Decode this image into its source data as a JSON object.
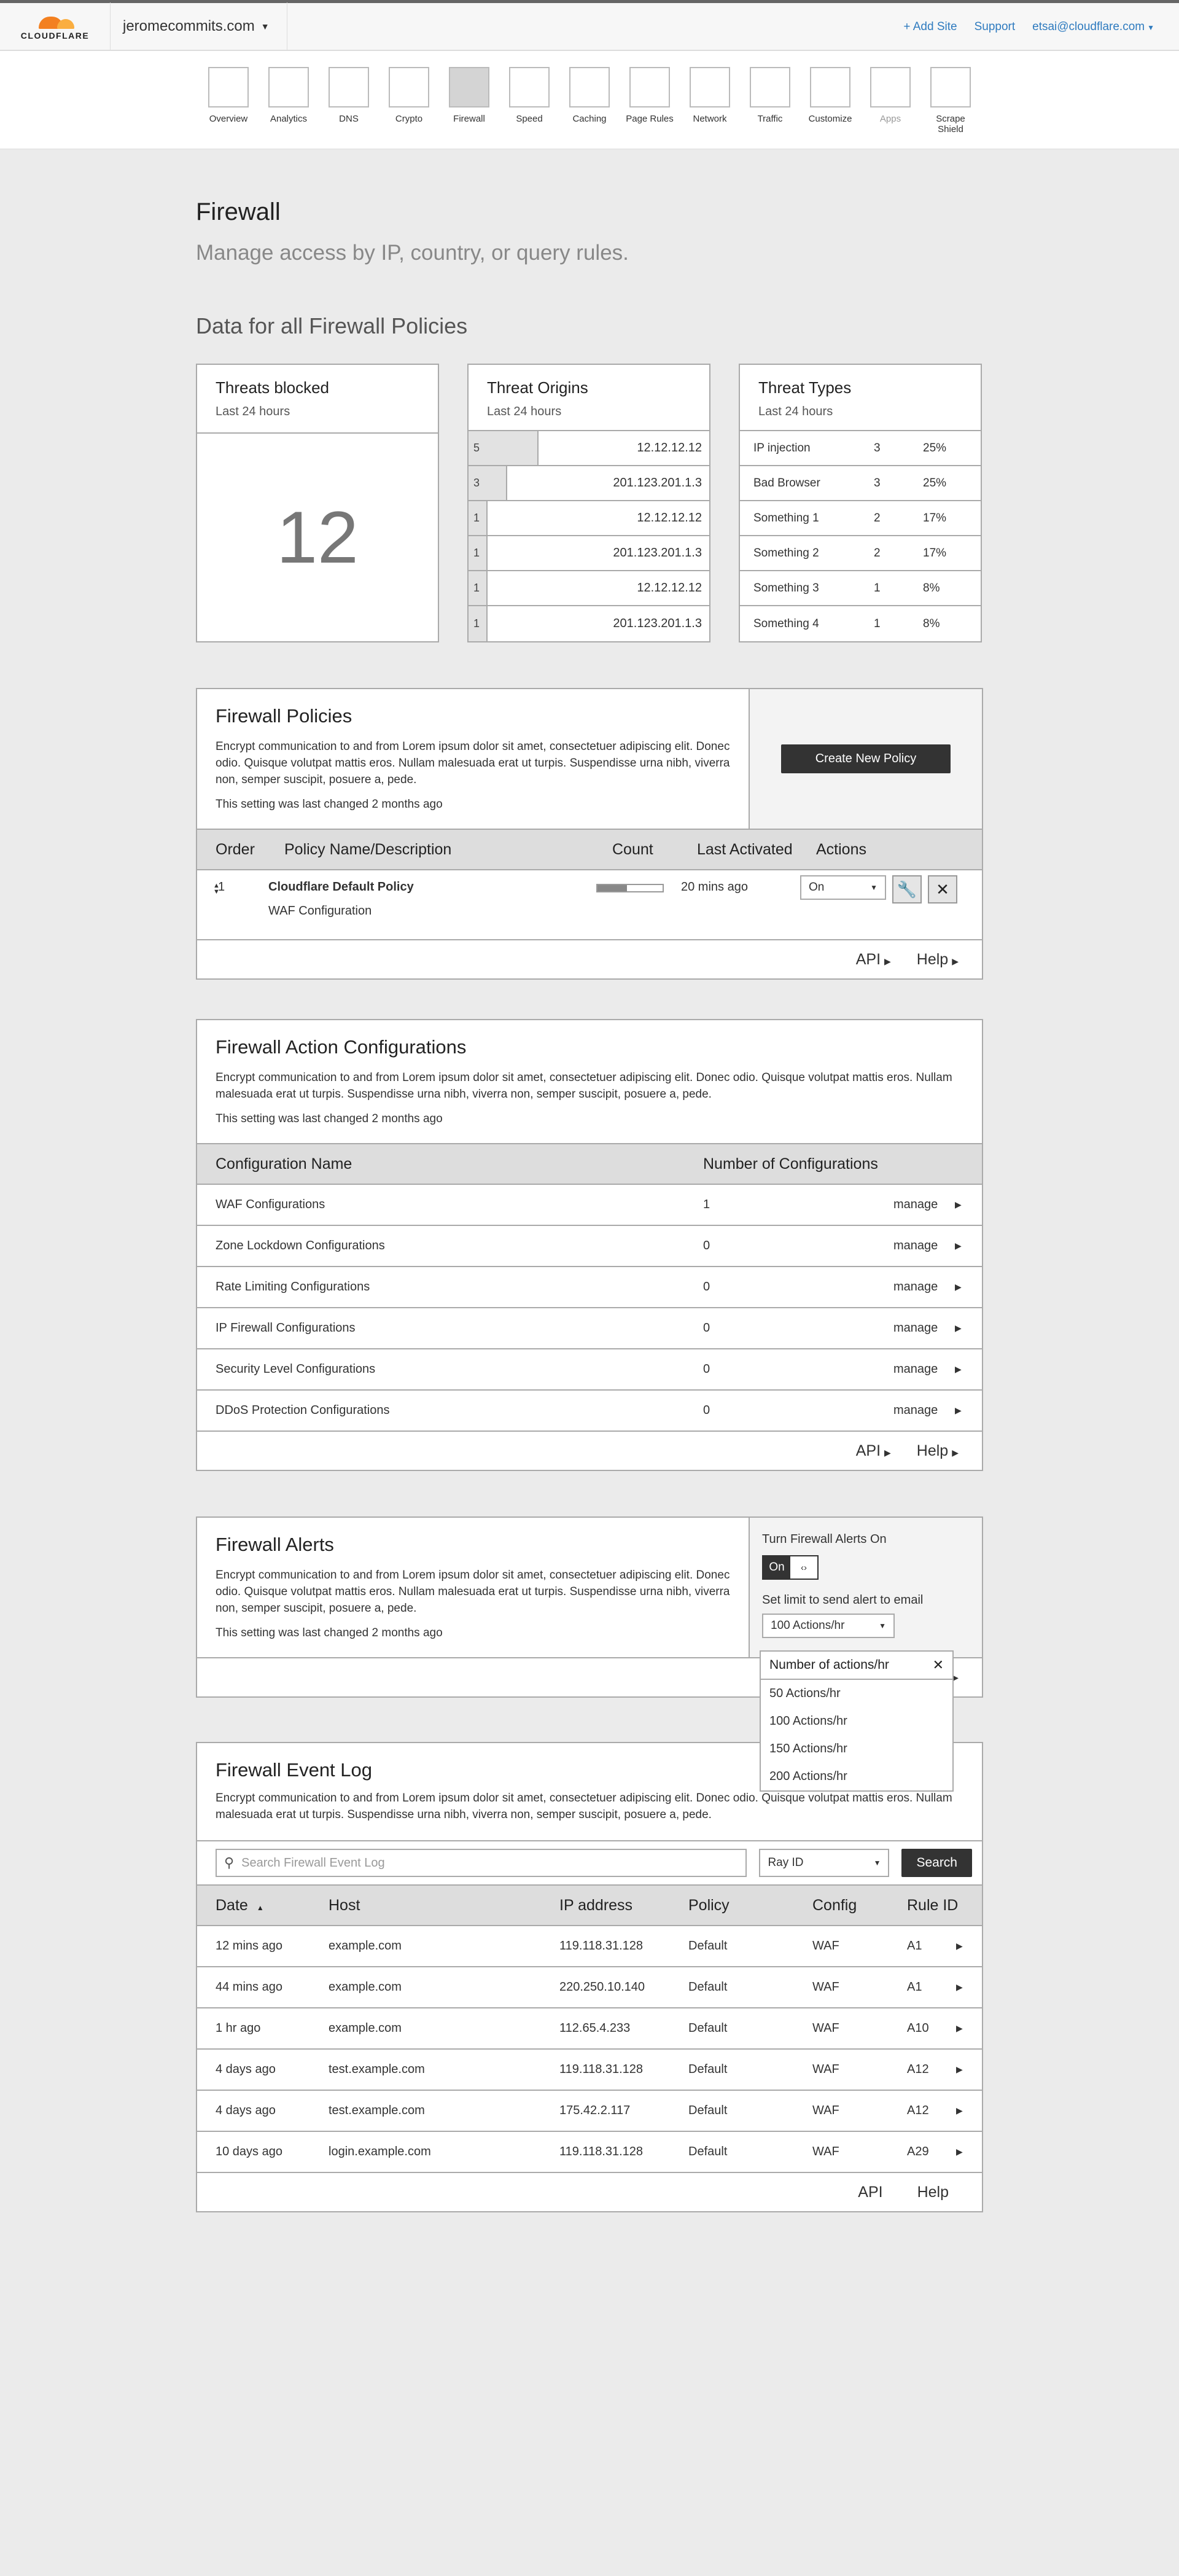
{
  "header": {
    "logo_text": "CLOUDFLARE",
    "domain": "jeromecommits.com",
    "add_site": "+ Add Site",
    "support": "Support",
    "user": "etsai@cloudflare.com"
  },
  "nav": [
    {
      "label": "Overview"
    },
    {
      "label": "Analytics"
    },
    {
      "label": "DNS"
    },
    {
      "label": "Crypto"
    },
    {
      "label": "Firewall"
    },
    {
      "label": "Speed"
    },
    {
      "label": "Caching"
    },
    {
      "label": "Page Rules"
    },
    {
      "label": "Network"
    },
    {
      "label": "Traffic"
    },
    {
      "label": "Customize"
    },
    {
      "label": "Apps"
    },
    {
      "label": "Scrape Shield"
    }
  ],
  "page": {
    "title": "Firewall",
    "subtitle": "Manage access by IP, country, or query rules.",
    "data_heading": "Data for all Firewall Policies"
  },
  "threats_blocked": {
    "title": "Threats blocked",
    "period": "Last 24 hours",
    "value": "12"
  },
  "threat_origins": {
    "title": "Threat Origins",
    "period": "Last 24 hours",
    "rows": [
      {
        "count": "5",
        "ip": "12.12.12.12",
        "share": 0.29
      },
      {
        "count": "3",
        "ip": "201.123.201.1.3",
        "share": 0.16
      },
      {
        "count": "1",
        "ip": "12.12.12.12",
        "share": 0.08
      },
      {
        "count": "1",
        "ip": "201.123.201.1.3",
        "share": 0.08
      },
      {
        "count": "1",
        "ip": "12.12.12.12",
        "share": 0.08
      },
      {
        "count": "1",
        "ip": "201.123.201.1.3",
        "share": 0.08
      }
    ]
  },
  "threat_types": {
    "title": "Threat Types",
    "period": "Last 24 hours",
    "rows": [
      {
        "name": "IP injection",
        "count": "3",
        "pct": "25%"
      },
      {
        "name": "Bad Browser",
        "count": "3",
        "pct": "25%"
      },
      {
        "name": "Something 1",
        "count": "2",
        "pct": "17%"
      },
      {
        "name": "Something 2",
        "count": "2",
        "pct": "17%"
      },
      {
        "name": "Something 3",
        "count": "1",
        "pct": "8%"
      },
      {
        "name": "Something 4",
        "count": "1",
        "pct": "8%"
      }
    ]
  },
  "policies": {
    "title": "Firewall Policies",
    "text": "Encrypt communication to and from Lorem ipsum dolor sit amet, consectetuer adipiscing elit. Donec odio. Quisque volutpat mattis eros. Nullam malesuada erat ut turpis. Suspendisse urna nibh, viverra non, semper suscipit, posuere a, pede.",
    "changed": "This setting was last changed 2 months ago",
    "create_button": "Create New Policy",
    "columns": {
      "order": "Order",
      "name": "Policy Name/Description",
      "count": "Count",
      "last": "Last Activated",
      "actions": "Actions"
    },
    "row": {
      "order": "1",
      "name": "Cloudflare Default Policy",
      "desc": "WAF Configuration",
      "count_level": 0.45,
      "last": "20 mins ago",
      "state": "On"
    },
    "api": "API",
    "help": "Help"
  },
  "actions": {
    "title": "Firewall Action Configurations",
    "text": "Encrypt communication to and from Lorem ipsum dolor sit amet, consectetuer adipiscing  elit. Donec odio. Quisque volutpat mattis eros. Nullam malesuada erat ut turpis. Suspendisse urna nibh, viverra non, semper suscipit, posuere a, pede.",
    "changed": "This setting was last changed 2 months ago",
    "columns": {
      "name": "Configuration Name",
      "number": "Number of Configurations"
    },
    "manage": "manage",
    "rows": [
      {
        "name": "WAF Configurations",
        "count": "1"
      },
      {
        "name": "Zone Lockdown Configurations",
        "count": "0"
      },
      {
        "name": "Rate Limiting Configurations",
        "count": "0"
      },
      {
        "name": "IP Firewall Configurations",
        "count": "0"
      },
      {
        "name": "Security Level Configurations",
        "count": "0"
      },
      {
        "name": "DDoS Protection Configurations",
        "count": "0"
      }
    ],
    "api": "API",
    "help": "Help"
  },
  "alerts": {
    "title": "Firewall Alerts",
    "text": "Encrypt communication to and from Lorem ipsum dolor sit amet, consectetuer adipiscing elit. Donec odio. Quisque volutpat mattis eros. Nullam malesuada erat ut turpis. Suspendisse urna nibh, viverra non, semper suscipit, posuere a, pede.",
    "changed": "This setting was last changed 2 months ago",
    "toggle_label": "Turn Firewall Alerts On",
    "toggle_on": "On",
    "toggle_off": "‹›",
    "limit_label": "Set limit to send alert to email",
    "limit_value": "100 Actions/hr",
    "dropdown": {
      "title": "Number of actions/hr",
      "options": [
        "50 Actions/hr",
        "100 Actions/hr",
        "150 Actions/hr",
        "200 Actions/hr"
      ]
    }
  },
  "log": {
    "title": "Firewall Event Log",
    "text": "Encrypt communication to and from Lorem ipsum dolor sit amet, consectetuer adipiscing  elit. Donec odio. Quisque volutpat mattis eros. Nullam malesuada erat ut turpis. Suspendisse urna nibh, viverra non, semper suscipit, posuere a, pede.",
    "search_placeholder": "Search Firewall Event Log",
    "filter": "Ray ID",
    "search_button": "Search",
    "columns": {
      "date": "Date",
      "host": "Host",
      "ip": "IP address",
      "policy": "Policy",
      "config": "Config",
      "rule": "Rule ID"
    },
    "rows": [
      {
        "date": "12 mins ago",
        "host": "example.com",
        "ip": "119.118.31.128",
        "policy": "Default",
        "config": "WAF",
        "rule": "A1"
      },
      {
        "date": "44 mins ago",
        "host": "example.com",
        "ip": "220.250.10.140",
        "policy": "Default",
        "config": "WAF",
        "rule": "A1"
      },
      {
        "date": "1 hr ago",
        "host": "example.com",
        "ip": "112.65.4.233",
        "policy": "Default",
        "config": "WAF",
        "rule": "A10"
      },
      {
        "date": "4 days ago",
        "host": "test.example.com",
        "ip": "119.118.31.128",
        "policy": "Default",
        "config": "WAF",
        "rule": "A12"
      },
      {
        "date": "4 days ago",
        "host": "test.example.com",
        "ip": "175.42.2.117",
        "policy": "Default",
        "config": "WAF",
        "rule": "A12"
      },
      {
        "date": "10 days ago",
        "host": "login.example.com",
        "ip": "119.118.31.128",
        "policy": "Default",
        "config": "WAF",
        "rule": "A29"
      }
    ],
    "api": "API",
    "help": "Help"
  }
}
